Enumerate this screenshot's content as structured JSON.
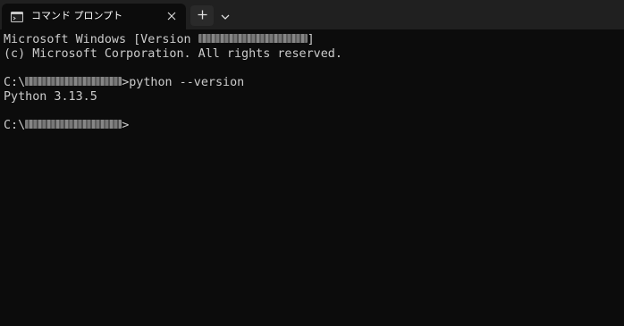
{
  "tab": {
    "title": "コマンド プロンプト",
    "icon": "terminal-icon",
    "close_icon": "close-icon"
  },
  "toolbar": {
    "new_tab_icon": "plus-icon",
    "dropdown_icon": "chevron-down-icon"
  },
  "terminal": {
    "line1_prefix": "Microsoft Windows [Version ",
    "line1_suffix": "]",
    "line2": "(c) Microsoft Corporation. All rights reserved.",
    "line3_prefix": "C:\\",
    "line3_command": ">python --version",
    "line4": "Python 3.13.5",
    "line5_prefix": "C:\\",
    "line5_suffix": ">"
  },
  "colors": {
    "background": "#0c0c0c",
    "titlebar": "#202020",
    "text": "#cccccc",
    "tab_text": "#ffffff"
  }
}
